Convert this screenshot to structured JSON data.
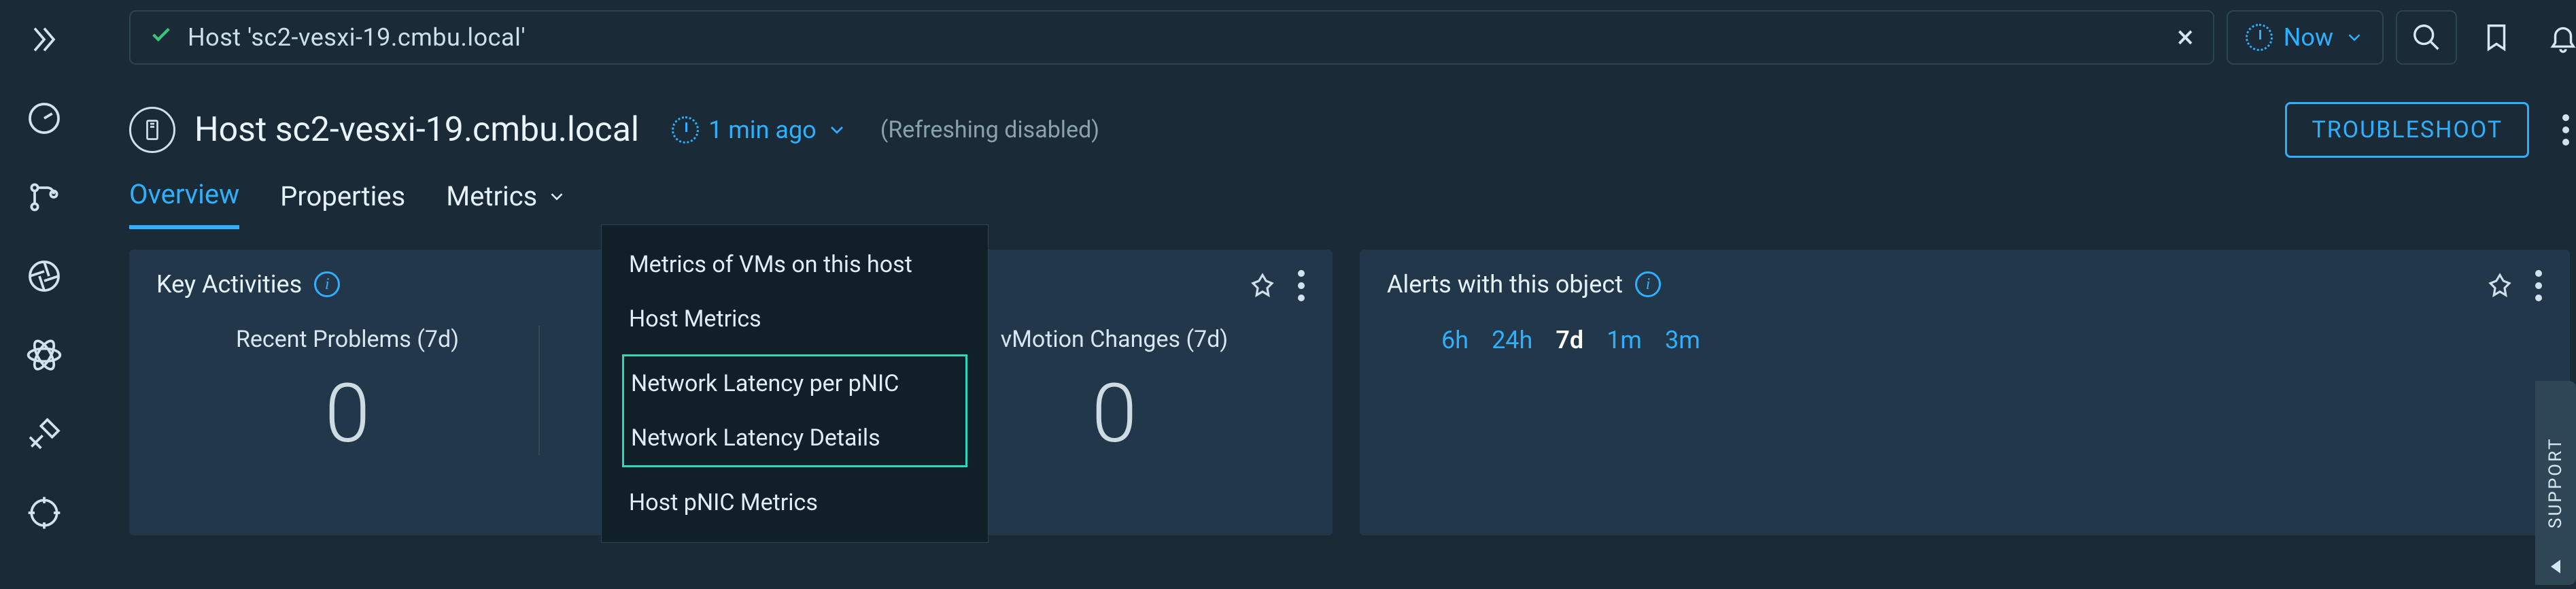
{
  "topbar": {
    "context_text": "Host 'sc2-vesxi-19.cmbu.local'",
    "now_label": "Now"
  },
  "header": {
    "title": "Host sc2-vesxi-19.cmbu.local",
    "refresh_age": "1 min ago",
    "refresh_note": "(Refreshing  disabled)",
    "troubleshoot_label": "TROUBLESHOOT"
  },
  "tabs": {
    "overview": "Overview",
    "properties": "Properties",
    "metrics": "Metrics"
  },
  "metrics_menu": {
    "vms": "Metrics of VMs on this host",
    "host_metrics": "Host Metrics",
    "latency_pnic": "Network Latency per pNIC",
    "latency_details": "Network Latency Details",
    "pnic_metrics": "Host pNIC Metrics"
  },
  "panel_left": {
    "title": "Key Activities",
    "cells": [
      {
        "label": "Recent Problems (7d)",
        "value": "0"
      },
      {
        "label": "",
        "value": ""
      },
      {
        "label": "vMotion Changes (7d)",
        "value": "0"
      }
    ]
  },
  "panel_right": {
    "title": "Alerts with this object",
    "times": [
      "6h",
      "24h",
      "7d",
      "1m",
      "3m"
    ],
    "active_time": "7d"
  },
  "support_tab": "SUPPORT"
}
